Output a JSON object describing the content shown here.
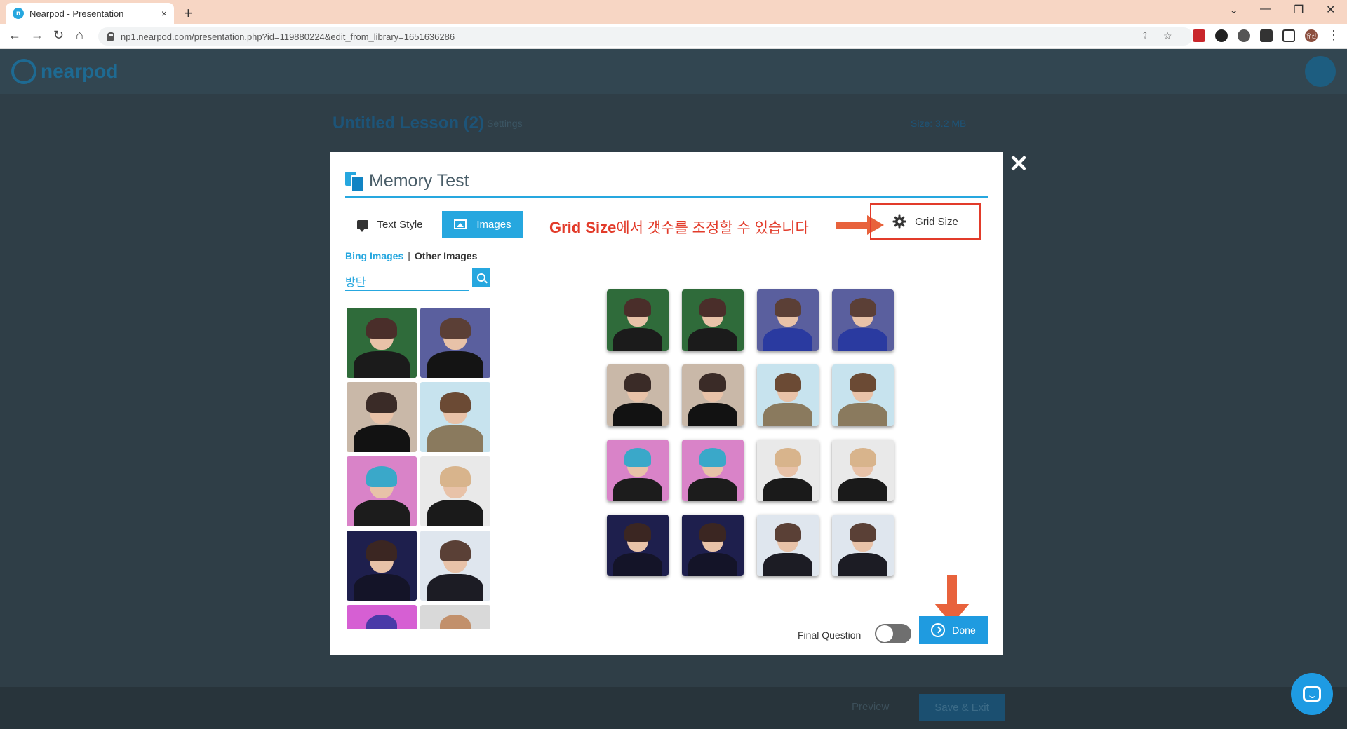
{
  "browser": {
    "tab_title": "Nearpod - Presentation",
    "tab_close": "×",
    "new_tab": "+",
    "url": "np1.nearpod.com/presentation.php?id=119880224&edit_from_library=1651636286",
    "back": "←",
    "forward": "→",
    "reload": "↻",
    "home": "⌂",
    "minimize": "—",
    "restore": "❐",
    "close": "✕",
    "chevron": "⌄",
    "share_icon": "⇪",
    "star_icon": "☆",
    "menu_icon": "⋮",
    "profile_initials": "유진"
  },
  "nearpod": {
    "logo_text": "nearpod",
    "lesson_title": "Untitled Lesson (2)",
    "settings_label": "Settings",
    "size_label": "Size: 3.2 MB",
    "preview_label": "Preview",
    "save_exit_label": "Save & Exit"
  },
  "modal": {
    "title": "Memory Test",
    "close_glyph": "✕",
    "tabs": {
      "text_style": "Text Style",
      "images": "Images"
    },
    "grid_size_label": "Grid Size",
    "annotation_bold": "Grid Size",
    "annotation_rest": "에서 갯수를 조정할 수 있습니다",
    "sources": {
      "bing": "Bing Images",
      "separator": "|",
      "other": "Other Images"
    },
    "search_value": "방탄",
    "final_question_label": "Final Question",
    "final_question_on": false,
    "done_label": "Done"
  },
  "colors": {
    "accent": "#26a7df",
    "annotation": "#e23b2a",
    "arrow": "#e8623c"
  },
  "result_thumbs": [
    {
      "bg": "#2f6b3a",
      "hair": "#4a2e2a",
      "body": "#1b1b1b"
    },
    {
      "bg": "#5a5f9e",
      "hair": "#5b3f36",
      "body": "#141414"
    },
    {
      "bg": "#c9b8a8",
      "hair": "#3a2b27",
      "body": "#121212"
    },
    {
      "bg": "#c7e3ee",
      "hair": "#6b4a34",
      "body": "#8a7a5e"
    },
    {
      "bg": "#d983c8",
      "hair": "#3aa8c9",
      "body": "#1c1c1c"
    },
    {
      "bg": "#e9e9e9",
      "hair": "#d8b48c",
      "body": "#1a1a1a"
    },
    {
      "bg": "#1e1f4d",
      "hair": "#3b2622",
      "body": "#141428"
    },
    {
      "bg": "#dfe6ee",
      "hair": "#5a4036",
      "body": "#1c1c24"
    },
    {
      "bg": "#d65fd3",
      "hair": "#4a3aa8",
      "body": "#2a2a2a"
    },
    {
      "bg": "#d9d9d9",
      "hair": "#c2906b",
      "body": "#222"
    }
  ],
  "grid_cards": [
    {
      "bg": "#2f6b3a",
      "hair": "#4a2e2a",
      "body": "#1b1b1b"
    },
    {
      "bg": "#2f6b3a",
      "hair": "#4a2e2a",
      "body": "#1b1b1b"
    },
    {
      "bg": "#5a5f9e",
      "hair": "#5b3f36",
      "body": "#2a3aa0"
    },
    {
      "bg": "#5a5f9e",
      "hair": "#5b3f36",
      "body": "#2a3aa0"
    },
    {
      "bg": "#c9b8a8",
      "hair": "#3a2b27",
      "body": "#121212"
    },
    {
      "bg": "#c9b8a8",
      "hair": "#3a2b27",
      "body": "#121212"
    },
    {
      "bg": "#c7e3ee",
      "hair": "#6b4a34",
      "body": "#8a7a5e"
    },
    {
      "bg": "#c7e3ee",
      "hair": "#6b4a34",
      "body": "#8a7a5e"
    },
    {
      "bg": "#d983c8",
      "hair": "#3aa8c9",
      "body": "#1c1c1c"
    },
    {
      "bg": "#d983c8",
      "hair": "#3aa8c9",
      "body": "#1c1c1c"
    },
    {
      "bg": "#e9e9e9",
      "hair": "#d8b48c",
      "body": "#1a1a1a"
    },
    {
      "bg": "#e9e9e9",
      "hair": "#d8b48c",
      "body": "#1a1a1a"
    },
    {
      "bg": "#1e1f4d",
      "hair": "#3b2622",
      "body": "#141428"
    },
    {
      "bg": "#1e1f4d",
      "hair": "#3b2622",
      "body": "#141428"
    },
    {
      "bg": "#dfe6ee",
      "hair": "#5a4036",
      "body": "#1c1c24"
    },
    {
      "bg": "#dfe6ee",
      "hair": "#5a4036",
      "body": "#1c1c24"
    }
  ]
}
